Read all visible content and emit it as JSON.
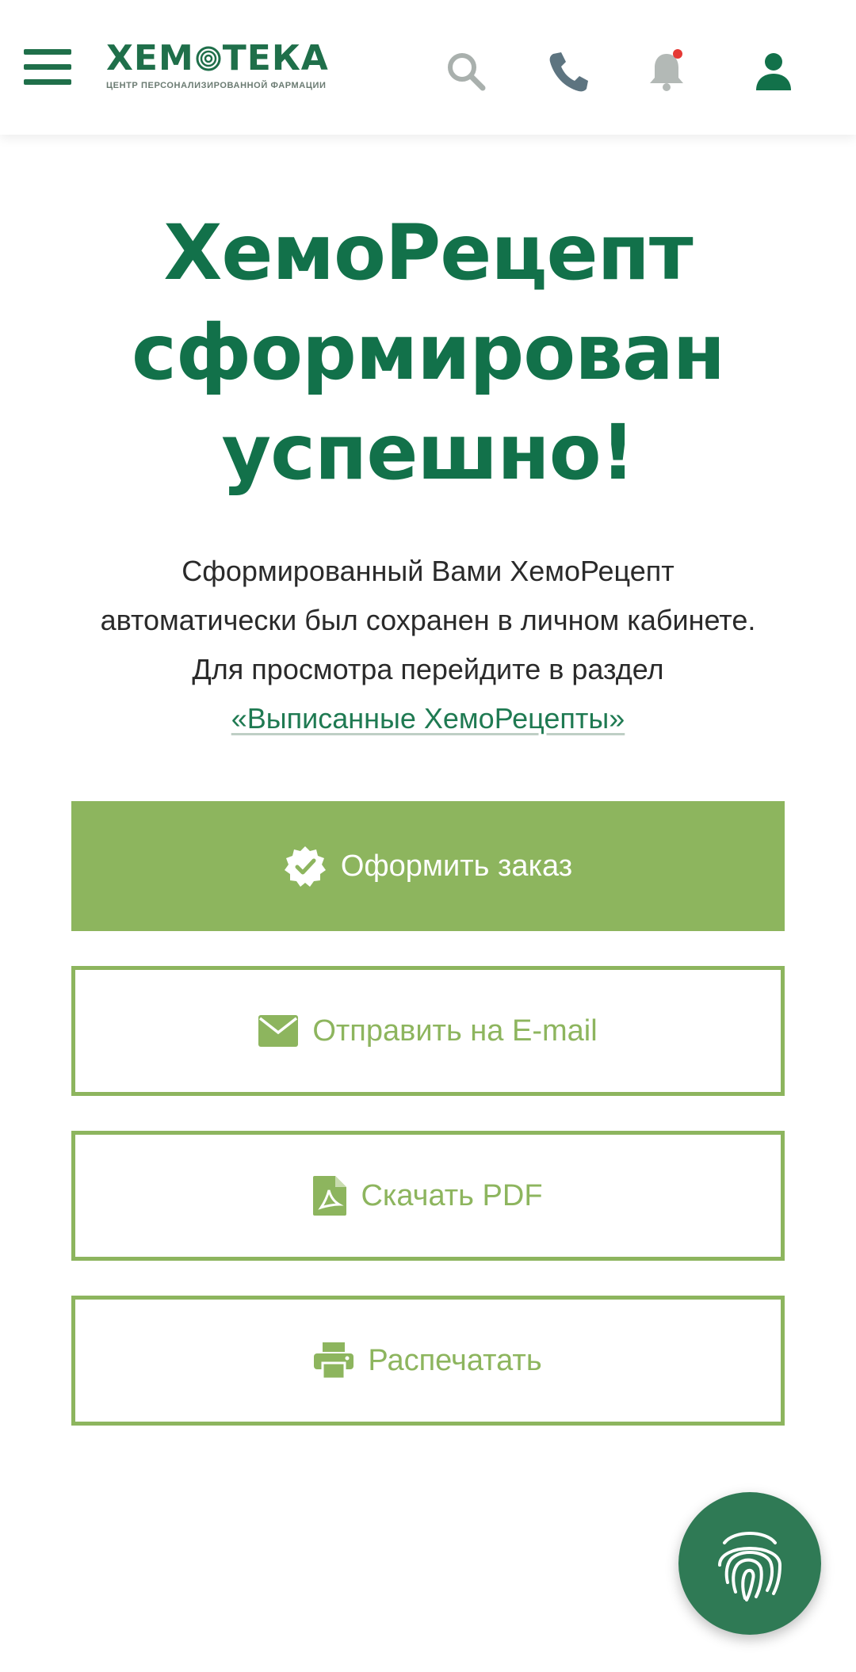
{
  "header": {
    "logo_text_left": "ХЕМ",
    "logo_text_right": "ТЕКА",
    "logo_subtitle": "ЦЕНТР ПЕРСОНАЛИЗИРОВАННОЙ ФАРМАЦИИ",
    "icons": [
      "menu-icon",
      "search-icon",
      "phone-icon",
      "bell-icon",
      "user-icon"
    ],
    "notification_dot_color": "#e53935"
  },
  "main": {
    "title_lines": [
      "ХемоРецепт",
      "сформирован",
      "успешно!"
    ],
    "description_lines": [
      "Сформированный Вами ХемоРецепт",
      "автоматически был сохранен в личном кабинете.",
      "Для просмотра перейдите в раздел"
    ],
    "link_text": "«Выписанные ХемоРецепты»"
  },
  "buttons": {
    "order": {
      "label": "Оформить заказ",
      "icon": "verified-check-icon"
    },
    "email": {
      "label": "Отправить на E-mail",
      "icon": "envelope-icon"
    },
    "pdf": {
      "label": "Скачать PDF",
      "icon": "pdf-file-icon"
    },
    "print": {
      "label": "Распечатать",
      "icon": "printer-icon"
    }
  },
  "fab": {
    "icon": "fingerprint-icon"
  },
  "colors": {
    "brand_dark": "#12714a",
    "accent_green": "#8db55e",
    "fab_green": "#2f7a55"
  }
}
